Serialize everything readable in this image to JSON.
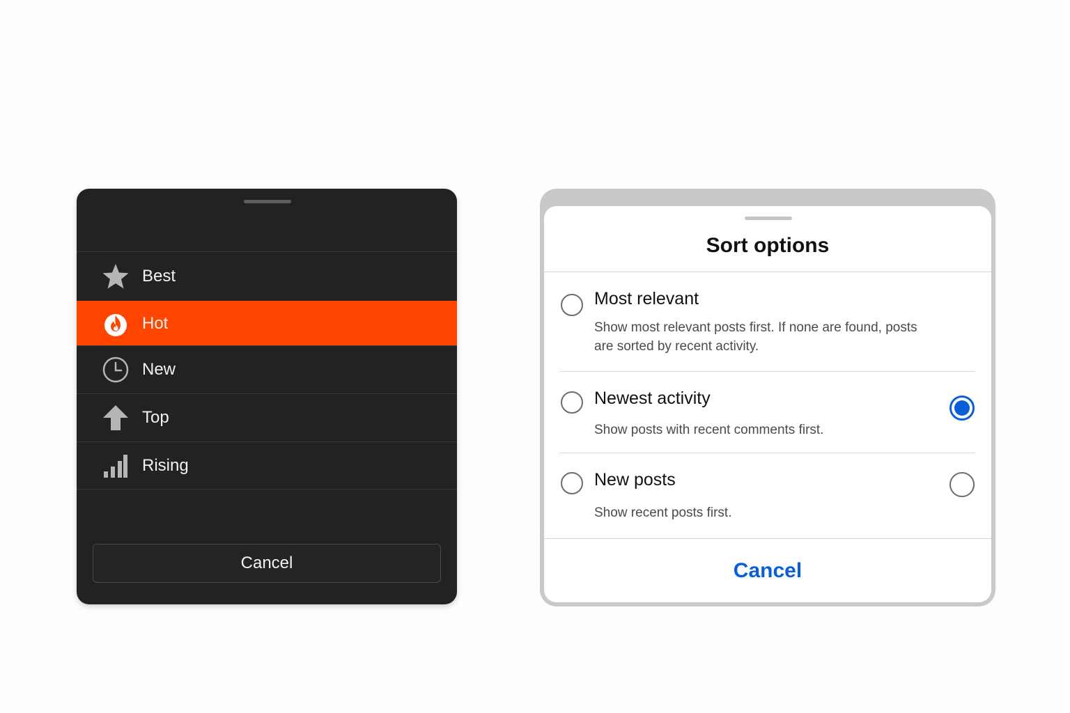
{
  "colors": {
    "dark_sheet_bg": "#222224",
    "highlight": "#ff4500",
    "accent_blue": "#0a5fd8"
  },
  "dark_sheet": {
    "items": [
      {
        "label": "Best",
        "icon": "star-icon",
        "active": false
      },
      {
        "label": "Hot",
        "icon": "flame-icon",
        "active": true
      },
      {
        "label": "New",
        "icon": "clock-icon",
        "active": false
      },
      {
        "label": "Top",
        "icon": "arrow-up-icon",
        "active": false
      },
      {
        "label": "Rising",
        "icon": "bar-chart-icon",
        "active": false
      }
    ],
    "cancel_label": "Cancel"
  },
  "light_sheet": {
    "title": "Sort options",
    "options": [
      {
        "title": "Most relevant",
        "description": "Show most relevant posts first. If none are found, posts are sorted by recent activity.",
        "selected": false
      },
      {
        "title": "Newest activity",
        "description": "Show posts with recent comments first.",
        "selected": true
      },
      {
        "title": "New posts",
        "description": "Show recent posts first.",
        "selected": false
      }
    ],
    "cancel_label": "Cancel"
  }
}
